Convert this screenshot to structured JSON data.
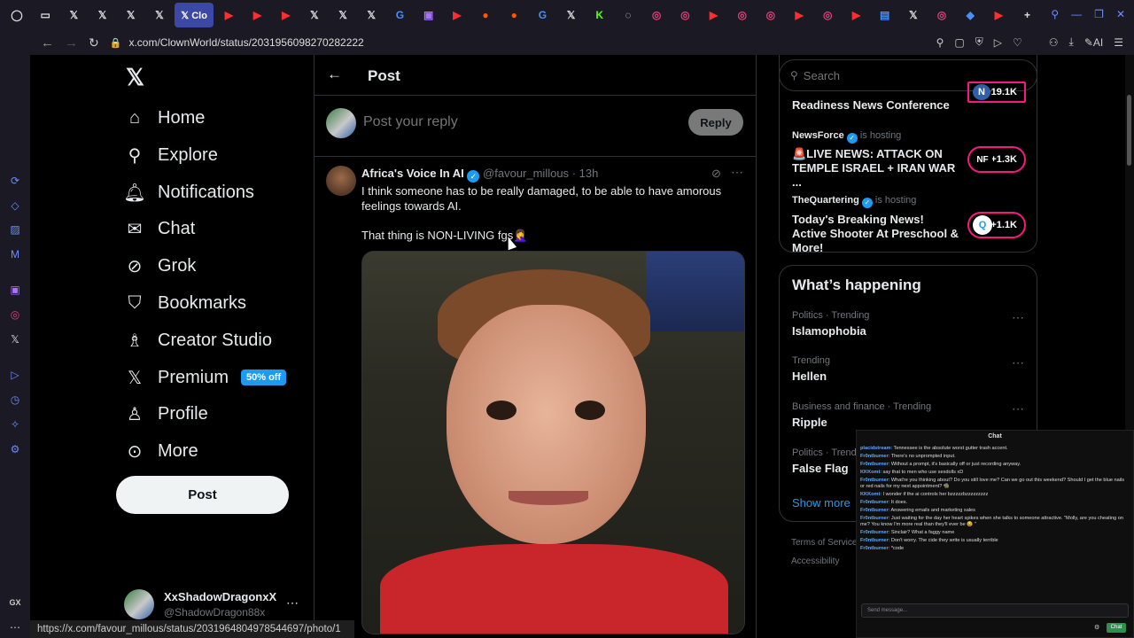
{
  "browser": {
    "tabs": [
      {
        "icon": "opera-icon",
        "glyph": "◯",
        "cls": ""
      },
      {
        "icon": "gamepad-icon",
        "glyph": "▭",
        "cls": ""
      },
      {
        "icon": "x-icon",
        "glyph": "𝕏",
        "cls": ""
      },
      {
        "icon": "x-icon",
        "glyph": "𝕏",
        "cls": ""
      },
      {
        "icon": "x-icon",
        "glyph": "𝕏",
        "cls": ""
      },
      {
        "icon": "x-icon",
        "glyph": "𝕏",
        "cls": ""
      },
      {
        "icon": "x-icon",
        "glyph": "𝕏 Clo",
        "cls": "active"
      },
      {
        "icon": "youtube-icon",
        "glyph": "▶",
        "cls": "yt"
      },
      {
        "icon": "play-icon",
        "glyph": "▶",
        "cls": "yt"
      },
      {
        "icon": "play-icon",
        "glyph": "▶",
        "cls": "yt"
      },
      {
        "icon": "x-icon",
        "glyph": "𝕏",
        "cls": ""
      },
      {
        "icon": "x-icon",
        "glyph": "𝕏",
        "cls": ""
      },
      {
        "icon": "x-icon",
        "glyph": "𝕏",
        "cls": ""
      },
      {
        "icon": "google-icon",
        "glyph": "G",
        "cls": "g"
      },
      {
        "icon": "twitch-icon",
        "glyph": "▣",
        "cls": "tw"
      },
      {
        "icon": "youtube-icon",
        "glyph": "▶",
        "cls": "yt"
      },
      {
        "icon": "reddit-icon",
        "glyph": "●",
        "cls": "rd"
      },
      {
        "icon": "reddit-icon",
        "glyph": "●",
        "cls": "rd"
      },
      {
        "icon": "google-icon",
        "glyph": "G",
        "cls": "g"
      },
      {
        "icon": "x-icon",
        "glyph": "𝕏",
        "cls": ""
      },
      {
        "icon": "kick-icon",
        "glyph": "K",
        "cls": "kk"
      },
      {
        "icon": "github-icon",
        "glyph": "◌",
        "cls": ""
      },
      {
        "icon": "instagram-icon",
        "glyph": "◎",
        "cls": "ig"
      },
      {
        "icon": "instagram-icon",
        "glyph": "◎",
        "cls": "ig"
      },
      {
        "icon": "youtube-icon",
        "glyph": "▶",
        "cls": "yt"
      },
      {
        "icon": "instagram-icon",
        "glyph": "◎",
        "cls": "ig"
      },
      {
        "icon": "instagram-icon",
        "glyph": "◎",
        "cls": "ig"
      },
      {
        "icon": "youtube-icon",
        "glyph": "▶",
        "cls": "yt"
      },
      {
        "icon": "instagram-icon",
        "glyph": "◎",
        "cls": "ig"
      },
      {
        "icon": "youtube-icon",
        "glyph": "▶",
        "cls": "yt"
      },
      {
        "icon": "app-icon",
        "glyph": "▤",
        "cls": "g"
      },
      {
        "icon": "x-icon",
        "glyph": "𝕏",
        "cls": ""
      },
      {
        "icon": "instagram-icon",
        "glyph": "◎",
        "cls": "ig"
      },
      {
        "icon": "edge-icon",
        "glyph": "◆",
        "cls": "g"
      },
      {
        "icon": "youtube-icon",
        "glyph": "▶",
        "cls": "yt"
      },
      {
        "icon": "new-tab-icon",
        "glyph": "+",
        "cls": ""
      }
    ],
    "url": "x.com/ClownWorld/status/2031956098270282222",
    "ai_label": "AI",
    "status_url": "https://x.com/favour_millous/status/2031964804978544697/photo/1"
  },
  "nav": {
    "home": "Home",
    "explore": "Explore",
    "notifications": "Notifications",
    "chat": "Chat",
    "grok": "Grok",
    "bookmarks": "Bookmarks",
    "creator_studio": "Creator Studio",
    "premium": "Premium",
    "premium_badge": "50% off",
    "profile": "Profile",
    "more": "More",
    "post_button": "Post"
  },
  "account": {
    "name": "XxShadowDragonxX",
    "handle": "@ShadowDragon88x"
  },
  "header": {
    "title": "Post"
  },
  "reply": {
    "placeholder": "Post your reply",
    "button": "Reply"
  },
  "post": {
    "author": "Africa's Voice In AI",
    "handle": "@favour_millous",
    "time": "· 13h",
    "text_line1": "I think someone has to be really damaged, to be able to have amorous",
    "text_line2": "feelings towards AI.",
    "text_line3": "That thing is NON-LIVING fgs🤦‍♀️"
  },
  "search": {
    "placeholder": "Search"
  },
  "spaces": [
    {
      "host": "",
      "title": "Readiness News Conference",
      "count": "+19.1K",
      "avatar": "N",
      "hosting": ""
    },
    {
      "host": "NewsForce",
      "hosting": "is hosting",
      "title": "🚨LIVE NEWS:  ATTACK  ON TEMPLE ISRAEL + IRAN WAR ...",
      "count": "+1.3K",
      "avatar": "NF"
    },
    {
      "host": "TheQuartering",
      "hosting": "is hosting",
      "title": "Today's Breaking News! Active Shooter At Preschool & More!",
      "count": "+1.1K",
      "avatar": "Q"
    }
  ],
  "happening": {
    "title": "What’s happening",
    "trends": [
      {
        "meta": "Politics · Trending",
        "name": "Islamophobia"
      },
      {
        "meta": "Trending",
        "name": "Hellen"
      },
      {
        "meta": "Business and finance · Trending",
        "name": "Ripple"
      },
      {
        "meta": "Politics · Trending",
        "name": "False Flag"
      }
    ],
    "show_more": "Show more"
  },
  "footer": {
    "terms": "Terms of Service",
    "accessibility": "Accessibility"
  },
  "chat": {
    "title": "Chat",
    "messages": [
      {
        "user": "placidstream",
        "text": "Tennessee is the absolute worst gutter trash accent."
      },
      {
        "user": "Fr0ntburner",
        "text": "There's no unprompted input."
      },
      {
        "user": "Fr0ntburner",
        "text": "Without a prompt, it's basically off or just recording anyway."
      },
      {
        "user": "KKKomt",
        "text": "say that to men who use sexdolls xD"
      },
      {
        "user": "Fr0ntburner",
        "text": "What're you thinking about? Do you still love me? Can we go out this weekend? Should I get the blue nails or red nails for my next appointment? 🧌"
      },
      {
        "user": "KKKomt",
        "text": "I wonder if the ai controls her bzzzzzbzzzzzzzzz"
      },
      {
        "user": "Fr0ntburner",
        "text": "It does."
      },
      {
        "user": "Fr0ntburner",
        "text": "Answering emails and marketing sales"
      },
      {
        "user": "Fr0ntburner",
        "text": "Just waiting for the day her heart spikes when she talks to someone attractive. \"Molly, are you cheating on me? You know I'm more real than they'll ever be 😂 \""
      },
      {
        "user": "Fr0ntburner",
        "text": "Sinclair? What a faggy name"
      },
      {
        "user": "Fr0ntburner",
        "text": "Don't worry. The cide they write is usually terrible"
      },
      {
        "user": "Fr0ntburner",
        "text": "*code"
      }
    ],
    "input_placeholder": "Send message...",
    "send": "Chat"
  },
  "rail_label": "GX"
}
